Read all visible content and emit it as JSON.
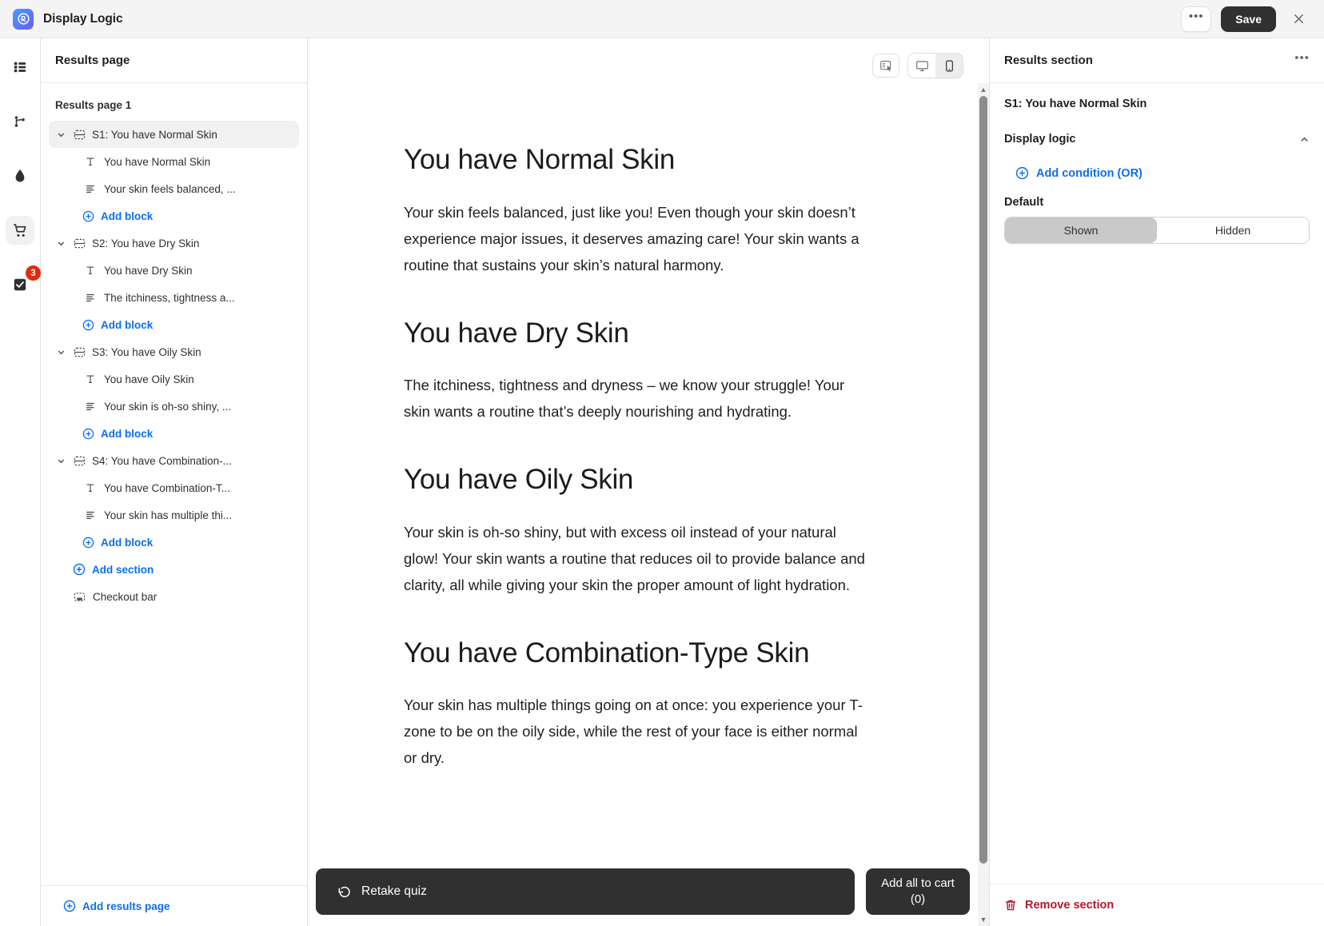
{
  "topbar": {
    "app_title": "Display Logic",
    "logo_icon": "display-logic-logo",
    "more_label": "•••",
    "save_label": "Save",
    "close_icon": "close-icon"
  },
  "rail": {
    "items": [
      {
        "icon": "content-blocks-icon",
        "name": "content",
        "active": false
      },
      {
        "icon": "branch-logic-icon",
        "name": "logic",
        "active": false
      },
      {
        "icon": "droplet-theme-icon",
        "name": "theme",
        "active": false
      },
      {
        "icon": "cart-icon",
        "name": "cart",
        "active": true
      },
      {
        "icon": "checkbox-results-icon",
        "name": "results",
        "active": false,
        "badge": "3"
      }
    ]
  },
  "sidebar": {
    "header": "Results page",
    "root_label": "Results page 1",
    "sections": [
      {
        "label": "S1: You have Normal Skin",
        "selected": true,
        "blocks": [
          {
            "icon": "text-block-icon",
            "label": "You have Normal Skin"
          },
          {
            "icon": "paragraph-block-icon",
            "label": "Your skin feels balanced, ..."
          }
        ],
        "add_block_label": "Add block"
      },
      {
        "label": "S2: You have Dry Skin",
        "selected": false,
        "blocks": [
          {
            "icon": "text-block-icon",
            "label": "You have Dry Skin"
          },
          {
            "icon": "paragraph-block-icon",
            "label": "The itchiness, tightness a..."
          }
        ],
        "add_block_label": "Add block"
      },
      {
        "label": "S3: You have Oily Skin",
        "selected": false,
        "blocks": [
          {
            "icon": "text-block-icon",
            "label": "You have Oily Skin"
          },
          {
            "icon": "paragraph-block-icon",
            "label": "Your skin is oh-so shiny, ..."
          }
        ],
        "add_block_label": "Add block"
      },
      {
        "label": "S4: You have Combination-...",
        "selected": false,
        "blocks": [
          {
            "icon": "text-block-icon",
            "label": "You have Combination-T..."
          },
          {
            "icon": "paragraph-block-icon",
            "label": "Your skin has multiple thi..."
          }
        ],
        "add_block_label": "Add block"
      }
    ],
    "add_section_label": "Add section",
    "checkout_bar_label": "Checkout bar",
    "add_results_page_label": "Add results page"
  },
  "canvas": {
    "toolbar": [
      {
        "icon": "interactive-preview-icon",
        "name": "preview-mode",
        "active": false
      },
      {
        "icon": "desktop-icon",
        "name": "desktop-view",
        "active": false
      },
      {
        "icon": "mobile-icon",
        "name": "mobile-view",
        "active": true
      }
    ],
    "blocks": [
      {
        "heading": "You have Normal Skin",
        "body": "Your skin feels balanced, just like you! Even though your skin doesn’t experience major issues, it deserves amazing care! Your skin wants a routine that sustains your skin’s natural harmony."
      },
      {
        "heading": "You have Dry Skin",
        "body": "The itchiness, tightness and dryness – we know your struggle! Your skin wants a routine that’s deeply nourishing and hydrating."
      },
      {
        "heading": "You have Oily Skin",
        "body": "Your skin is oh-so shiny, but with excess oil instead of your natural glow! Your skin wants a routine that reduces oil to provide balance and clarity, all while giving your skin the proper amount of light hydration."
      },
      {
        "heading": "You have Combination-Type Skin",
        "body": "Your skin has multiple things going on at once: you experience your T-zone to be on the oily side, while the rest of your face is either normal or dry."
      }
    ],
    "retake_label": "Retake quiz",
    "retake_icon": "undo-icon",
    "cart_label": "Add all to cart (0)"
  },
  "rightpanel": {
    "header": "Results section",
    "more_label": "•••",
    "section_name": "S1: You have Normal Skin",
    "display_logic_label": "Display logic",
    "add_condition_label": "Add condition (OR)",
    "default_label": "Default",
    "toggle": {
      "shown_label": "Shown",
      "hidden_label": "Hidden",
      "selected": "Shown"
    },
    "remove_label": "Remove section",
    "remove_icon": "trash-icon"
  },
  "colors": {
    "accent_blue": "#0c6ef2",
    "danger_red": "#b3182b",
    "badge_red": "#e02a0f",
    "dark": "#303030"
  }
}
